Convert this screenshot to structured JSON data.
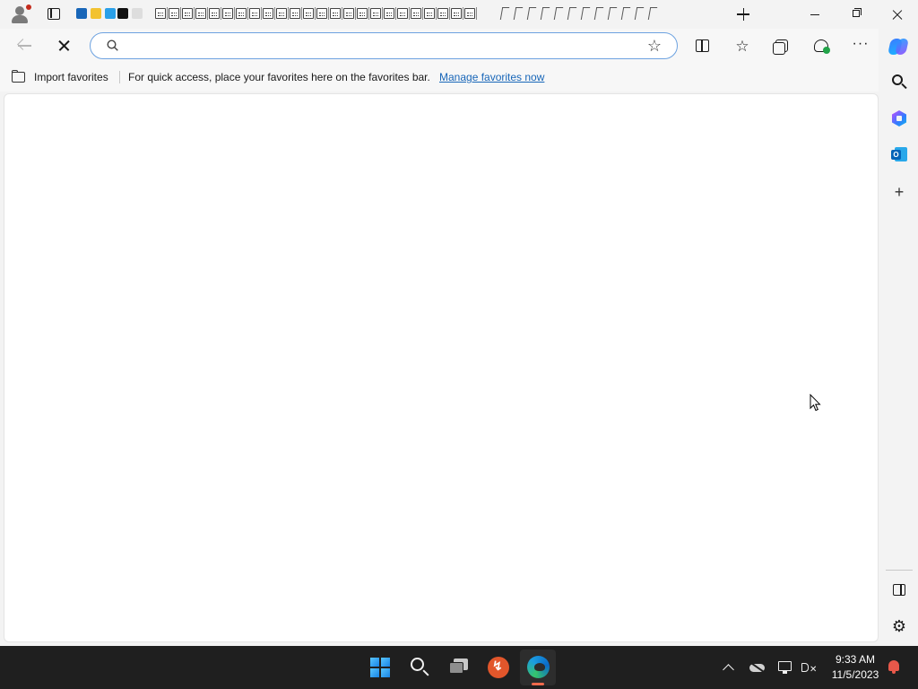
{
  "browser": {
    "search": {
      "value": "",
      "placeholder": ""
    }
  },
  "favorites_bar": {
    "import_label": "Import favorites",
    "message": "For quick access, place your favorites here on the favorites bar.",
    "manage_link": "Manage favorites now"
  },
  "taskbar": {
    "time": "9:33 AM",
    "date": "11/5/2023"
  },
  "icons": {
    "tabstrip": [
      "profile-icon",
      "tab-actions-icon",
      "new-tab-icon",
      "minimize-icon",
      "restore-icon",
      "close-icon"
    ],
    "toolbar": [
      "back-icon",
      "stop-icon",
      "search-icon",
      "star-icon",
      "split-screen-icon",
      "favorites-icon",
      "collections-icon",
      "performance-icon",
      "more-icon",
      "copilot-icon"
    ],
    "sidebar": [
      "search-icon",
      "microsoft-365-icon",
      "outlook-icon",
      "add-icon",
      "hide-sidebar-icon",
      "settings-icon"
    ],
    "taskbar": [
      "windows-start-icon",
      "search-icon",
      "task-view-icon",
      "remote-desktop-icon",
      "edge-icon",
      "chevron-up-icon",
      "onedrive-icon",
      "network-icon",
      "volume-icon",
      "notification-bell-icon"
    ]
  },
  "colors": {
    "accent": "#1866b8",
    "address_border": "#6da2e0",
    "taskbar_bg": "#1f1f1f",
    "notification": "#e8584a"
  }
}
